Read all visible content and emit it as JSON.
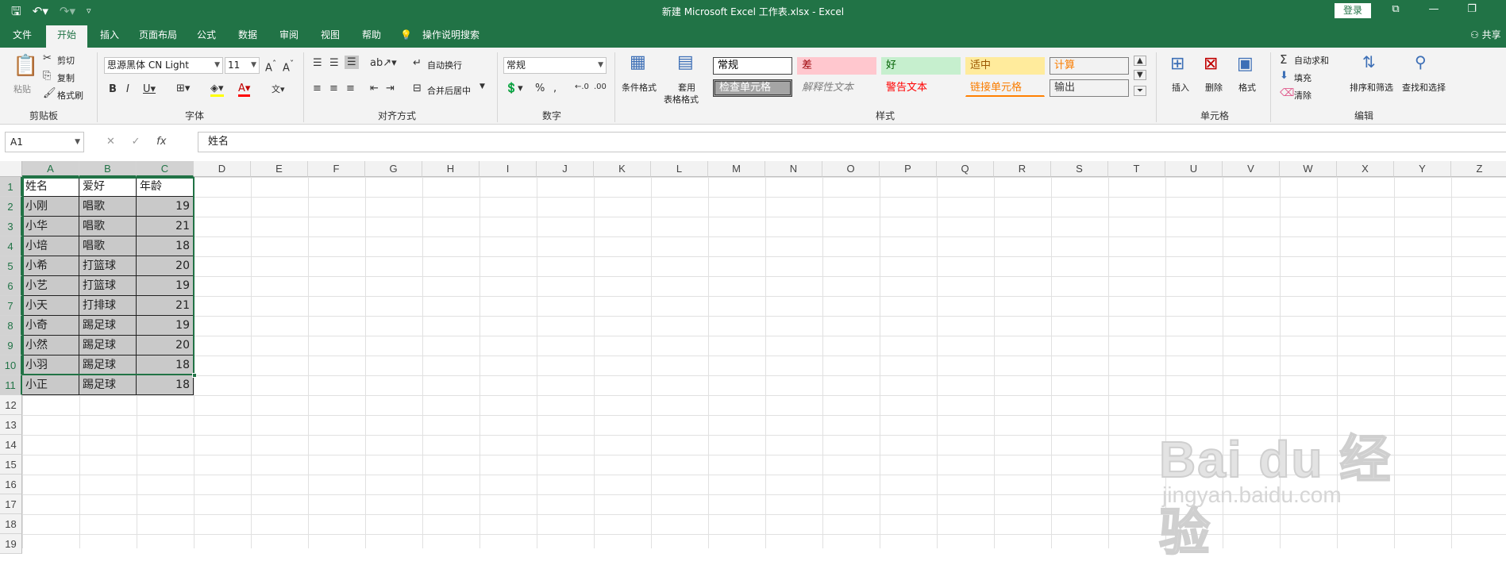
{
  "window": {
    "title": "新建 Microsoft Excel 工作表.xlsx  -  Excel",
    "login_label": "登录",
    "qat_icons": [
      "save-icon",
      "undo-icon",
      "redo-icon",
      "customize-icon"
    ]
  },
  "tabs": [
    "文件",
    "开始",
    "插入",
    "页面布局",
    "公式",
    "数据",
    "审阅",
    "视图",
    "帮助"
  ],
  "active_tab": "开始",
  "tell_me": "操作说明搜索",
  "share_label": "共享",
  "ribbon": {
    "clipboard": {
      "label": "剪贴板",
      "paste": "粘贴",
      "cut": "剪切",
      "copy": "复制",
      "format_painter": "格式刷"
    },
    "font": {
      "label": "字体",
      "name": "思源黑体 CN Light",
      "size": "11"
    },
    "alignment": {
      "label": "对齐方式",
      "wrap": "自动换行",
      "merge": "合并后居中"
    },
    "number": {
      "label": "数字",
      "format": "常规"
    },
    "styles": {
      "label": "样式",
      "cond_format": "条件格式",
      "table_format_1": "套用",
      "table_format_2": "表格格式",
      "cells": [
        {
          "text": "常规",
          "bg": "#ffffff",
          "fg": "#000000"
        },
        {
          "text": "差",
          "bg": "#ffc7ce",
          "fg": "#9c0006"
        },
        {
          "text": "好",
          "bg": "#c6efce",
          "fg": "#006100"
        },
        {
          "text": "适中",
          "bg": "#ffeb9c",
          "fg": "#9c5700"
        },
        {
          "text": "计算",
          "bg": "#f2f2f2",
          "fg": "#fa7d00"
        },
        {
          "text": "检查单元格",
          "bg": "#a5a5a5",
          "fg": "#ffffff"
        },
        {
          "text": "解释性文本",
          "bg": "transparent",
          "fg": "#7f7f7f"
        },
        {
          "text": "警告文本",
          "bg": "transparent",
          "fg": "#ff0000"
        },
        {
          "text": "链接单元格",
          "bg": "transparent",
          "fg": "#fa7d00"
        },
        {
          "text": "输出",
          "bg": "#f2f2f2",
          "fg": "#3f3f3f"
        }
      ]
    },
    "cells_group": {
      "label": "单元格",
      "insert": "插入",
      "delete": "删除",
      "format": "格式"
    },
    "editing": {
      "label": "编辑",
      "autosum": "自动求和",
      "fill": "填充",
      "clear": "清除",
      "sort": "排序和筛选",
      "find": "查找和选择"
    }
  },
  "formula_bar": {
    "name_box": "A1",
    "fx": "fx",
    "content": "姓名"
  },
  "columns": [
    "A",
    "B",
    "C",
    "D",
    "E",
    "F",
    "G",
    "H",
    "I",
    "J",
    "K",
    "L",
    "M",
    "N",
    "O",
    "P",
    "Q",
    "R",
    "S",
    "T",
    "U",
    "V",
    "W",
    "X",
    "Y",
    "Z"
  ],
  "rows": [
    "1",
    "2",
    "3",
    "4",
    "5",
    "6",
    "7",
    "8",
    "9",
    "10",
    "11",
    "12",
    "13",
    "14",
    "15",
    "16",
    "17",
    "18",
    "19"
  ],
  "table": {
    "headers": [
      "姓名",
      "爱好",
      "年龄"
    ],
    "rows": [
      [
        "小刚",
        "唱歌",
        "19"
      ],
      [
        "小华",
        "唱歌",
        "21"
      ],
      [
        "小培",
        "唱歌",
        "18"
      ],
      [
        "小希",
        "打篮球",
        "20"
      ],
      [
        "小艺",
        "打篮球",
        "19"
      ],
      [
        "小天",
        "打排球",
        "21"
      ],
      [
        "小奇",
        "踢足球",
        "19"
      ],
      [
        "小然",
        "踢足球",
        "20"
      ],
      [
        "小羽",
        "踢足球",
        "18"
      ],
      [
        "小正",
        "踢足球",
        "18"
      ]
    ]
  },
  "watermark": {
    "main": "Bai du 经验",
    "sub": "jingyan.baidu.com"
  }
}
